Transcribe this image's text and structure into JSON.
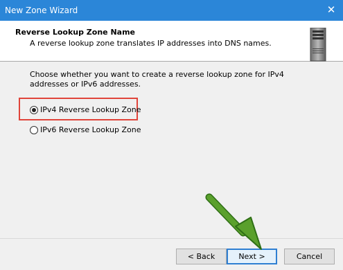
{
  "window": {
    "title": "New Zone Wizard",
    "close_glyph": "✕"
  },
  "header": {
    "title": "Reverse Lookup Zone Name",
    "subtitle": "A reverse lookup zone translates IP addresses into DNS names.",
    "icon": "server-icon"
  },
  "main": {
    "question": "Choose whether you want to create a reverse lookup zone for IPv4 addresses or IPv6 addresses.",
    "options": [
      {
        "label": "IPv4 Reverse Lookup Zone",
        "selected": true
      },
      {
        "label": "IPv6 Reverse Lookup Zone",
        "selected": false
      }
    ]
  },
  "buttons": {
    "back": "< Back",
    "next": "Next >",
    "cancel": "Cancel"
  },
  "colors": {
    "titlebar": "#2b86d8",
    "highlight": "#e0443a",
    "arrow": "#5aa02c"
  }
}
